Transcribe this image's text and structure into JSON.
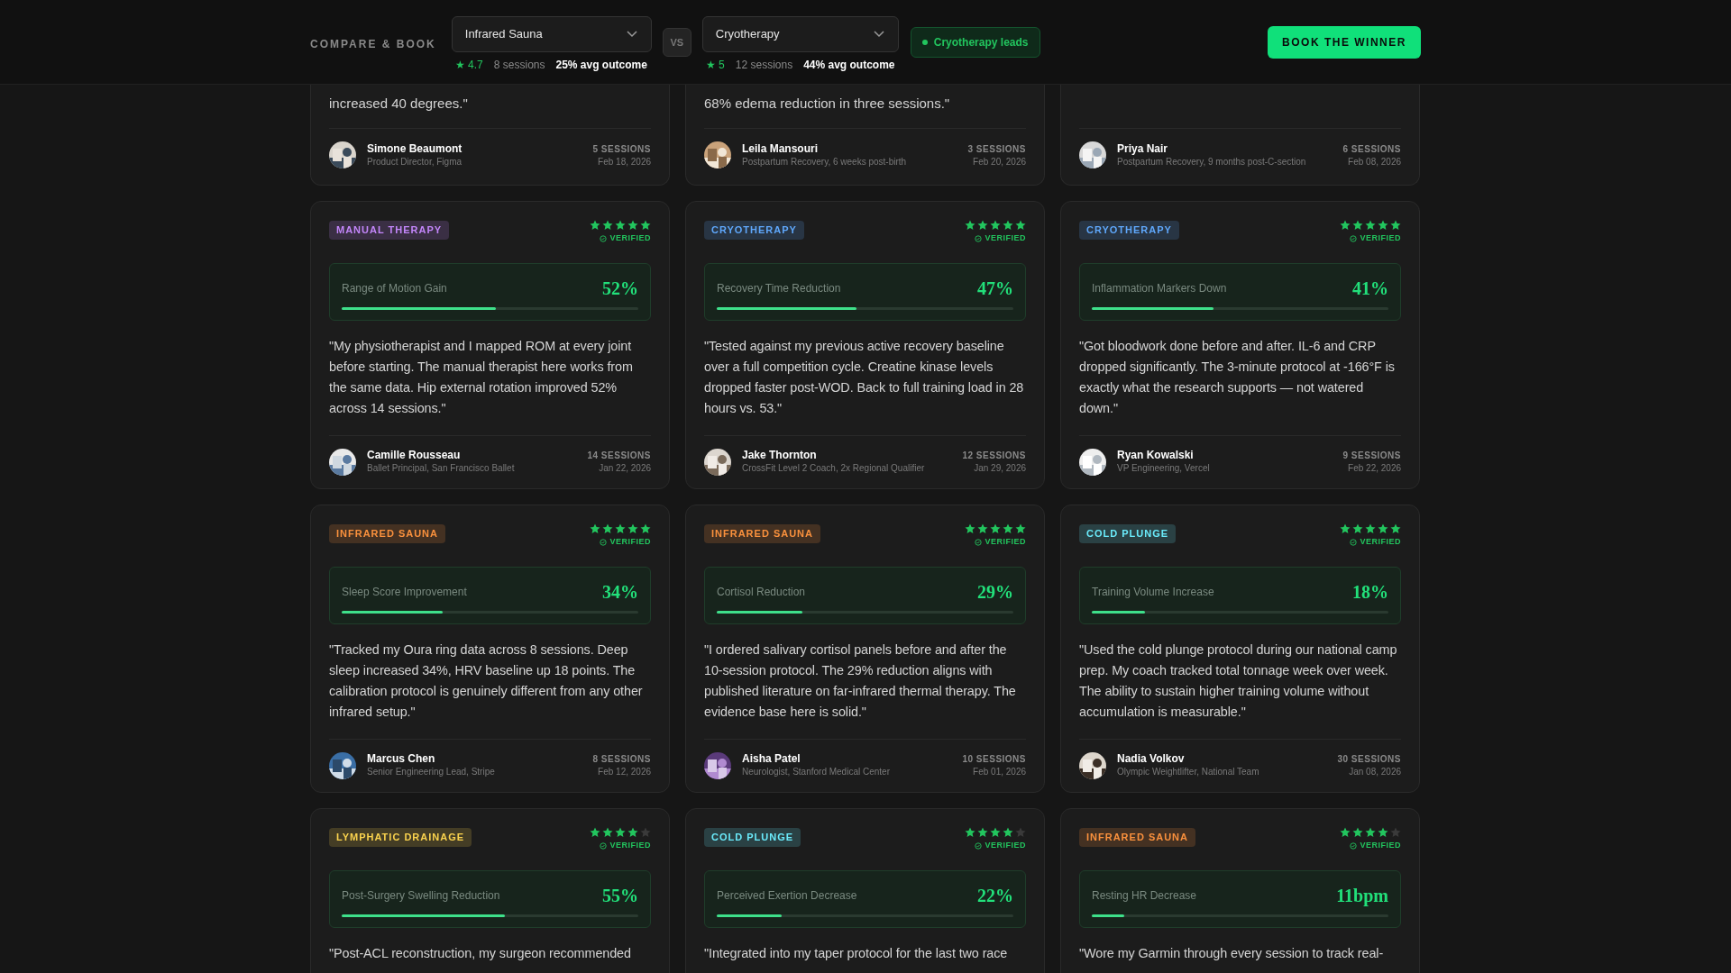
{
  "header": {
    "label": "COMPARE & BOOK",
    "selects": [
      {
        "value": "Infrared Sauna",
        "rating": "★ 4.7",
        "sessions": "8 sessions",
        "outcome": "25% avg outcome"
      },
      {
        "value": "Cryotherapy",
        "rating": "★ 5",
        "sessions": "12 sessions",
        "outcome": "44% avg outcome"
      }
    ],
    "vs": "VS",
    "leader": "Cryotherapy leads",
    "button": "BOOK THE WINNER"
  },
  "partial_cards": [
    {
      "quote_end": "increased 40 degrees.\"",
      "name": "Simone Beaumont",
      "role": "Product Director, Figma",
      "sessions": "5 SESSIONS",
      "date": "Feb 18, 2026"
    },
    {
      "quote_end": "68% edema reduction in three sessions.\"",
      "name": "Leila Mansouri",
      "role": "Postpartum Recovery, 6 weeks post-birth",
      "sessions": "3 SESSIONS",
      "date": "Feb 20, 2026"
    },
    {
      "name": "Priya Nair",
      "role": "Postpartum Recovery, 9 months post-C-section",
      "sessions": "6 SESSIONS",
      "date": "Feb 08, 2026"
    }
  ],
  "cards": [
    {
      "tag": "MANUAL THERAPY",
      "color": "#3a2f44",
      "stars": 5,
      "verified": "VERIFIED",
      "metric": "Range of Motion Gain",
      "value": "52%",
      "level": 0.52,
      "quote": "\"My physiotherapist and I mapped ROM at every joint before starting. The manual therapist here works from the same data. Hip external rotation improved 52% across 14 sessions.\"",
      "name": "Camille Rousseau",
      "role": "Ballet Principal, San Francisco Ballet",
      "sessions": "14 SESSIONS",
      "date": "Jan 22, 2026"
    },
    {
      "tag": "CRYOTHERAPY",
      "color": "#283544",
      "stars": 5,
      "verified": "VERIFIED",
      "metric": "Recovery Time Reduction",
      "value": "47%",
      "level": 0.47,
      "quote": "\"Tested against my previous active recovery baseline over a full competition cycle. Creatine kinase levels dropped faster post-WOD. Back to full training load in 28 hours vs. 53.\"",
      "name": "Jake Thornton",
      "role": "CrossFit Level 2 Coach, 2x Regional Qualifier",
      "sessions": "12 SESSIONS",
      "date": "Jan 29, 2026"
    },
    {
      "tag": "CRYOTHERAPY",
      "color": "#283544",
      "stars": 5,
      "verified": "VERIFIED",
      "metric": "Inflammation Markers Down",
      "value": "41%",
      "level": 0.41,
      "quote": "\"Got bloodwork done before and after. IL-6 and CRP dropped significantly. The 3-minute protocol at -166°F is exactly what the research supports — not watered down.\"",
      "name": "Ryan Kowalski",
      "role": "VP Engineering, Vercel",
      "sessions": "9 SESSIONS",
      "date": "Feb 22, 2026"
    },
    {
      "tag": "INFRARED SAUNA",
      "color": "#443122",
      "stars": 5,
      "verified": "VERIFIED",
      "metric": "Sleep Score Improvement",
      "value": "34%",
      "level": 0.34,
      "quote": "\"Tracked my Oura ring data across 8 sessions. Deep sleep increased 34%, HRV baseline up 18 points. The calibration protocol is genuinely different from any other infrared setup.\"",
      "name": "Marcus Chen",
      "role": "Senior Engineering Lead, Stripe",
      "sessions": "8 SESSIONS",
      "date": "Feb 12, 2026"
    },
    {
      "tag": "INFRARED SAUNA",
      "color": "#443122",
      "stars": 5,
      "verified": "VERIFIED",
      "metric": "Cortisol Reduction",
      "value": "29%",
      "level": 0.29,
      "quote": "\"I ordered salivary cortisol panels before and after the 10-session protocol. The 29% reduction aligns with published literature on far-infrared thermal therapy. The evidence base here is solid.\"",
      "name": "Aisha Patel",
      "role": "Neurologist, Stanford Medical Center",
      "sessions": "10 SESSIONS",
      "date": "Feb 01, 2026"
    },
    {
      "tag": "COLD PLUNGE",
      "color": "#2a4144",
      "stars": 5,
      "verified": "VERIFIED",
      "metric": "Training Volume Increase",
      "value": "18%",
      "level": 0.18,
      "quote": "\"Used the cold plunge protocol during our national camp prep. My coach tracked total tonnage week over week. The ability to sustain higher training volume without accumulation is measurable.\"",
      "name": "Nadia Volkov",
      "role": "Olympic Weightlifter, National Team",
      "sessions": "30 SESSIONS",
      "date": "Jan 08, 2026"
    },
    {
      "tag": "LYMPHATIC DRAINAGE",
      "color": "#443d25",
      "stars": 4,
      "verified": "VERIFIED",
      "metric": "Post-Surgery Swelling Reduction",
      "value": "55%",
      "level": 0.55,
      "quote": "\"Post-ACL reconstruction, my surgeon recommended"
    },
    {
      "tag": "COLD PLUNGE",
      "color": "#2a4144",
      "stars": 4,
      "verified": "VERIFIED",
      "metric": "Perceived Exertion Decrease",
      "value": "22%",
      "level": 0.22,
      "quote": "\"Integrated into my taper protocol for the last two race"
    },
    {
      "tag": "INFRARED SAUNA",
      "color": "#443122",
      "stars": 4,
      "verified": "VERIFIED",
      "metric": "Resting HR Decrease",
      "value": "11bpm",
      "level": 0.11,
      "quote": "\"Wore my Garmin through every session to track real-"
    }
  ]
}
